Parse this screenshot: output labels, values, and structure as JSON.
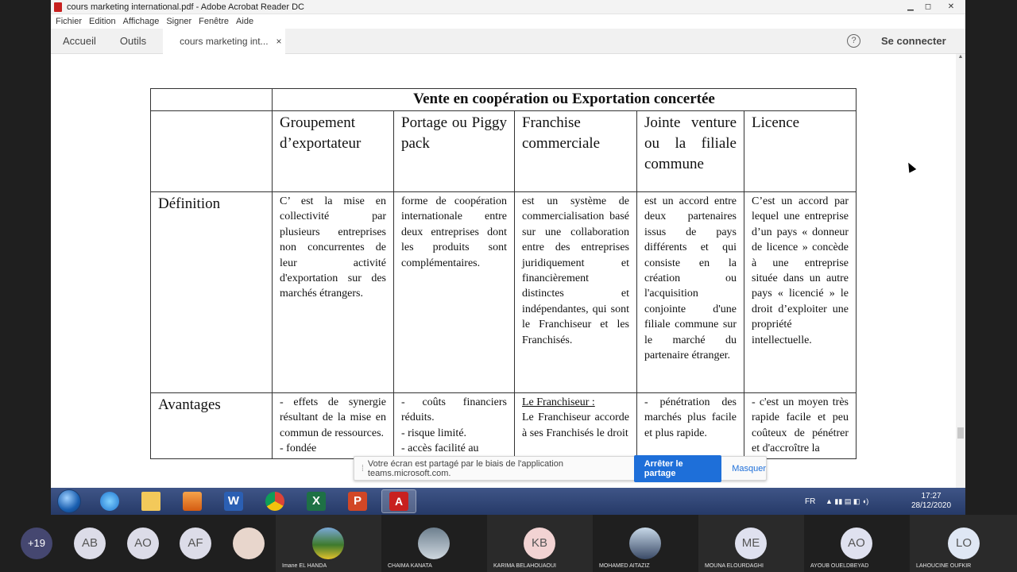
{
  "window": {
    "title": "cours marketing international.pdf - Adobe Acrobat Reader DC",
    "controls": [
      "▁",
      "◻",
      "✕"
    ]
  },
  "menu": [
    "Fichier",
    "Edition",
    "Affichage",
    "Signer",
    "Fenêtre",
    "Aide"
  ],
  "tabs": {
    "home": "Accueil",
    "tools": "Outils",
    "document": "cours marketing int...",
    "close": "×",
    "help": "?",
    "connect": "Se connecter"
  },
  "table": {
    "title": "Vente en coopération ou Exportation concertée",
    "columns": [
      "Groupement d’exportateur",
      "Portage ou Piggy pack",
      "Franchise commerciale",
      "Jointe venture ou la filiale commune",
      "Licence"
    ],
    "rows": [
      {
        "label": "Définition",
        "cells": [
          "C’ est la mise en collectivité par plusieurs entreprises non concurrentes de leur activité d'exportation sur des marchés étrangers.",
          "forme de coopération internationale entre deux entreprises dont les produits sont complémentaires.",
          "est un système de commercialisation basé sur une collaboration entre des entreprises juridiquement et financièrement distinctes et indépendantes, qui sont le Franchiseur et les Franchisés.",
          "est un accord entre deux partenaires issus de pays différents et qui consiste en la création ou l'acquisition conjointe d'une filiale commune sur le marché du partenaire étranger.",
          "C’est un accord par lequel une entreprise d’un pays « donneur de licence » concède à une entreprise située dans un autre pays « licencié » le droit d’exploiter une propriété intellectuelle."
        ]
      },
      {
        "label": "Avantages",
        "cells": [
          "- effets de synergie résultant de la mise en commun de ressources.\n- fondée",
          "- coûts financiers réduits.\n- risque limité.\n- accès facilité au",
          "Le Franchiseur :|Le Franchiseur accorde à ses Franchisés le droit",
          "- pénétration des marchés plus facile et plus rapide.",
          "- c'est un moyen très rapide facile et peu coûteux de pénétrer et d'accroître la"
        ]
      }
    ]
  },
  "share_notice": {
    "text": "Votre écran est partagé par le biais de l'application teams.microsoft.com.",
    "stop": "Arrêter le partage",
    "hide": "Masquer"
  },
  "taskbar": {
    "apps": [
      "start",
      "internet-explorer",
      "file-explorer",
      "media-player",
      "word",
      "chrome",
      "excel",
      "powerpoint",
      "acrobat"
    ],
    "lang": "FR",
    "time": "17:27",
    "date": "28/12/2020"
  },
  "participants": {
    "more": "+19",
    "avatars": [
      "AB",
      "AO",
      "AF"
    ],
    "named": [
      {
        "name": "Imane EL HANDA",
        "initials": ""
      },
      {
        "name": "CHAIMA KANATA",
        "initials": ""
      },
      {
        "name": "KARIMA BELAHOUAOUI",
        "initials": "KB"
      },
      {
        "name": "MOHAMED AITAZIZ",
        "initials": ""
      },
      {
        "name": "MOUNA ELOURDAGHI",
        "initials": "ME"
      },
      {
        "name": "AYOUB OUELDBEYAD",
        "initials": "AO"
      },
      {
        "name": "LAHOUCINE OUFKIR",
        "initials": "LO"
      }
    ]
  }
}
